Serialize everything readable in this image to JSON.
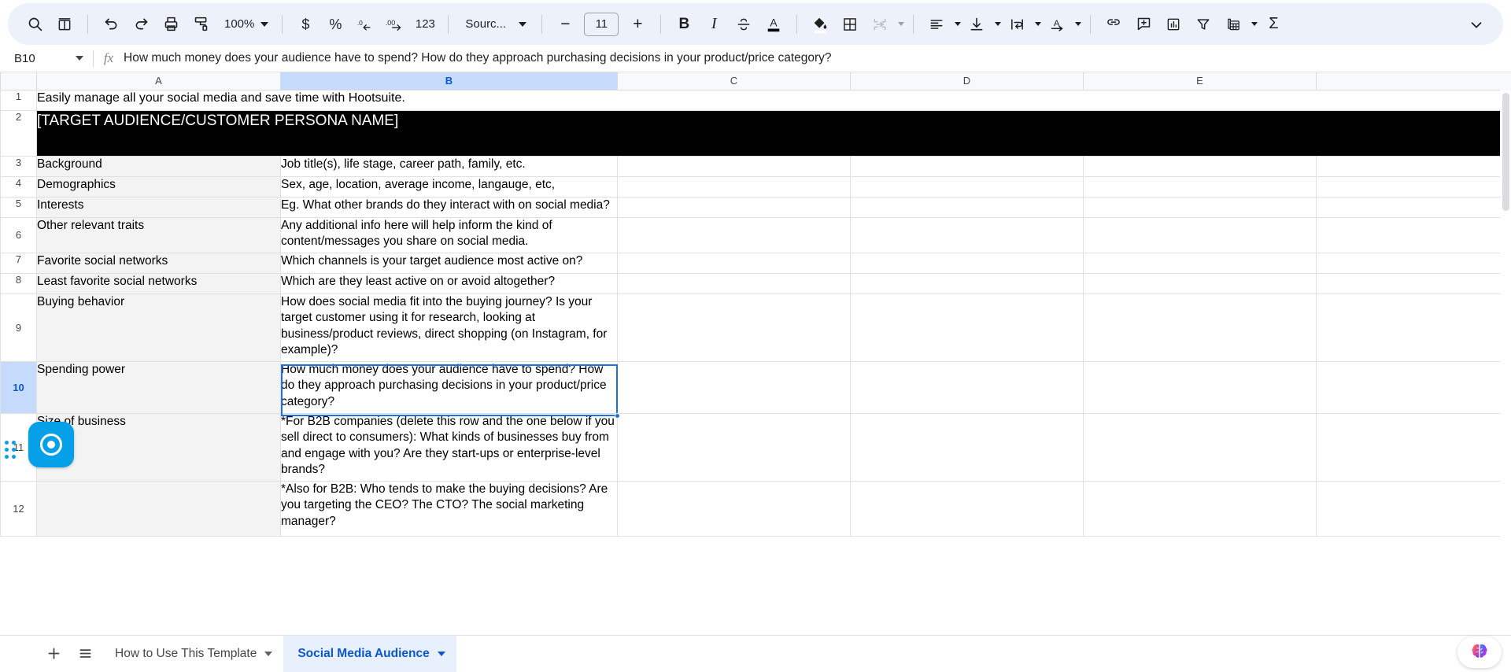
{
  "toolbar": {
    "search_label": "search-icon",
    "menus_label": "menus-icon",
    "undo_label": "undo-icon",
    "redo_label": "redo-icon",
    "print_label": "print-icon",
    "paint_label": "paint-format-icon",
    "zoom_value": "100%",
    "currency_label": "$",
    "percent_label": "%",
    "dec_decrease_label": ".0",
    "dec_increase_label": ".00",
    "number_format_label": "123",
    "font_name": "Sourc...",
    "font_minus": "−",
    "font_size": "11",
    "font_plus": "+",
    "bold_label": "B",
    "italic_label": "I",
    "strike_label": "S",
    "text_color_label": "A",
    "fill_color_label": "fill-color-icon",
    "borders_label": "borders-icon",
    "merge_label": "merge-cells-icon",
    "halign_label": "horizontal-align-icon",
    "valign_label": "vertical-align-icon",
    "wrap_label": "text-wrap-icon",
    "rotate_label": "text-rotation-icon",
    "link_label": "insert-link-icon",
    "comment_label": "insert-comment-icon",
    "chart_label": "insert-chart-icon",
    "filter_label": "create-filter-icon",
    "functions_label": "functions-icon",
    "sum_label": "Σ",
    "collapse_label": "chevron-down-icon"
  },
  "formula_bar": {
    "name_box_value": "B10",
    "fx_label": "fx",
    "formula_value": "How much money does your audience have to spend? How do they approach purchasing decisions in your product/price category?"
  },
  "grid": {
    "columns": [
      "A",
      "B",
      "C",
      "D",
      "E"
    ],
    "selected_column": "B",
    "selected_row": "10",
    "selected_cell": "B10",
    "rows": [
      {
        "num": "1",
        "a": "Easily manage all your social media and save time with Hootsuite.",
        "b": "",
        "type": "title"
      },
      {
        "num": "2",
        "a": "[TARGET AUDIENCE/CUSTOMER PERSONA NAME]",
        "b": "",
        "type": "banner"
      },
      {
        "num": "3",
        "a": "Background",
        "b": "Job title(s), life stage, career path, family, etc.",
        "type": "normal"
      },
      {
        "num": "4",
        "a": "Demographics",
        "b": "Sex, age, location, average income, langauge, etc,",
        "type": "normal"
      },
      {
        "num": "5",
        "a": "Interests",
        "b": "Eg. What other brands do they interact with on social media?",
        "type": "normal"
      },
      {
        "num": "6",
        "a": "Other relevant traits",
        "b": "Any additional info here will help inform the kind of content/messages you share on social media.",
        "type": "normal"
      },
      {
        "num": "7",
        "a": "Favorite social networks",
        "b": "Which channels is your target audience most active on?",
        "type": "normal"
      },
      {
        "num": "8",
        "a": "Least favorite social networks",
        "b": "Which are they least active on or avoid altogether?",
        "type": "normal"
      },
      {
        "num": "9",
        "a": "Buying behavior",
        "b": "How does social media fit into the buying journey? Is your target customer using it for research, looking at business/product reviews, direct shopping (on Instagram, for example)?",
        "type": "normal"
      },
      {
        "num": "10",
        "a": "Spending power",
        "b": "How much money does your audience have to spend? How do they approach purchasing decisions in your product/price category?",
        "type": "selected"
      },
      {
        "num": "11",
        "a": "Size of business",
        "b": "*For B2B companies (delete this row and the one below if you sell direct to consumers): What kinds of businesses buy from and engage with you? Are they start-ups or enterprise-level brands?",
        "type": "normal"
      },
      {
        "num": "12",
        "a": "",
        "b": "*Also for B2B: Who tends to make the buying decisions? Are you targeting the CEO? The CTO? The social marketing manager?",
        "type": "normal"
      }
    ]
  },
  "overlay": {
    "float_button_label": "record-button",
    "drag_handle_label": "drag-handle"
  },
  "bottom": {
    "add_sheet_label": "+",
    "all_sheets_label": "≡",
    "tabs": [
      {
        "label": "How to Use This Template",
        "active": false
      },
      {
        "label": "Social Media Audience",
        "active": true
      }
    ],
    "ai_label": "ai-assistant-icon"
  }
}
